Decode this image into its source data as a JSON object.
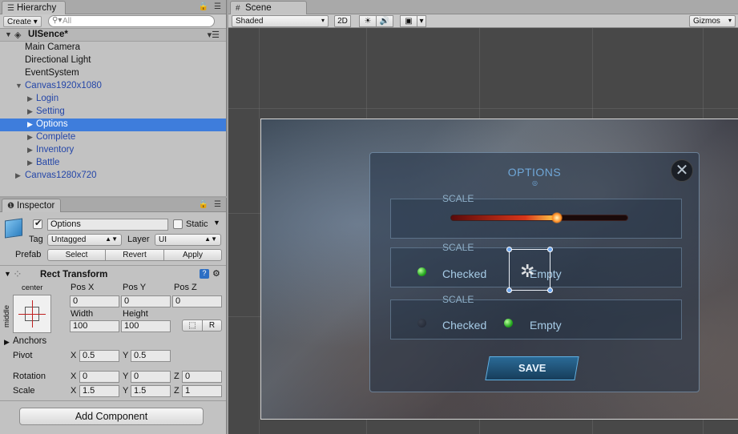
{
  "hierarchy": {
    "tab_label": "Hierarchy",
    "create_label": "Create",
    "search_placeholder": "All",
    "scene_name": "UISence*",
    "items": [
      {
        "label": "Main Camera"
      },
      {
        "label": "Directional Light"
      },
      {
        "label": "EventSystem"
      },
      {
        "label": "Canvas1920x1080"
      },
      {
        "label": "Login"
      },
      {
        "label": "Setting"
      },
      {
        "label": "Options"
      },
      {
        "label": "Complete"
      },
      {
        "label": "Inventory"
      },
      {
        "label": "Battle"
      },
      {
        "label": "Canvas1280x720"
      }
    ]
  },
  "inspector": {
    "tab_label": "Inspector",
    "object_name": "Options",
    "static_label": "Static",
    "tag_label": "Tag",
    "tag_value": "Untagged",
    "layer_label": "Layer",
    "layer_value": "UI",
    "prefab_label": "Prefab",
    "prefab_buttons": [
      "Select",
      "Revert",
      "Apply"
    ],
    "rect_transform": {
      "title": "Rect Transform",
      "anchor_h": "center",
      "anchor_v": "middle",
      "pos_x_label": "Pos X",
      "pos_y_label": "Pos Y",
      "pos_z_label": "Pos Z",
      "pos_x": "0",
      "pos_y": "0",
      "pos_z": "0",
      "width_label": "Width",
      "height_label": "Height",
      "width": "100",
      "height": "100",
      "r_button": "R",
      "anchors_label": "Anchors",
      "pivot_label": "Pivot",
      "pivot_x": "0.5",
      "pivot_y": "0.5",
      "rotation_label": "Rotation",
      "rotation_x": "0",
      "rotation_y": "0",
      "rotation_z": "0",
      "scale_label": "Scale",
      "scale_x": "1.5",
      "scale_y": "1.5",
      "scale_z": "1"
    },
    "axis_x": "X",
    "axis_y": "Y",
    "axis_z": "Z",
    "add_component": "Add Component"
  },
  "scene": {
    "tab_label": "Scene",
    "shading_mode": "Shaded",
    "btn_2d": "2D",
    "gizmos_label": "Gizmos",
    "ui": {
      "title": "OPTIONS",
      "close_glyph": "✕",
      "sections": [
        {
          "label": "SCALE",
          "slider_value": 0.6
        },
        {
          "label": "SCALE",
          "checked": "Checked",
          "empty": "Empty",
          "selected": "Checked"
        },
        {
          "label": "SCALE",
          "checked": "Checked",
          "empty": "Empty",
          "selected": "Empty"
        }
      ],
      "save_label": "SAVE"
    }
  },
  "colors": {
    "selection": "#3e7ddc",
    "prefab_blue": "#2446a8",
    "ui_accent": "#6fa7d8"
  }
}
